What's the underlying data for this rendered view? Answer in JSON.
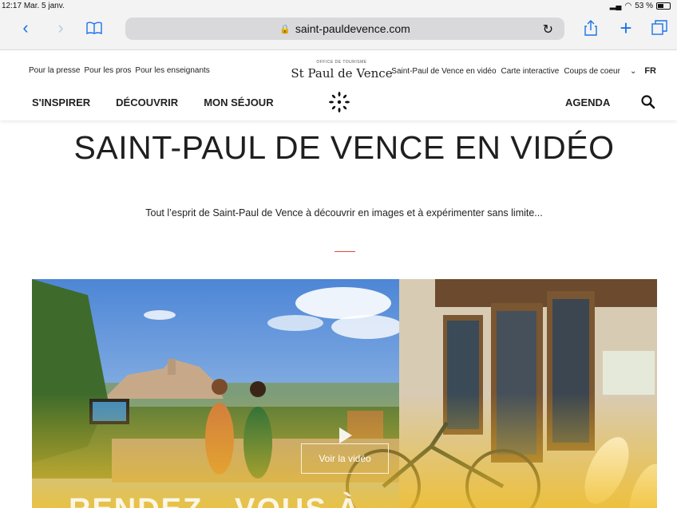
{
  "status_bar": {
    "time": "12:17",
    "date": "Mar. 5 janv.",
    "battery": "53 %",
    "battery_level": 0.53
  },
  "browser": {
    "url": "saint-pauldevence.com"
  },
  "colors": {
    "accent": "#1a73e8",
    "rule": "#d94a3b",
    "logo_sun": "#111111"
  },
  "header": {
    "top_links_left": [
      "Pour la presse",
      "Pour les pros",
      "Pour les enseignants"
    ],
    "top_links_right": [
      "Saint-Paul de Vence en vidéo",
      "Carte interactive",
      "Coups de coeur"
    ],
    "language": "FR",
    "logo_office": "OFFICE DE TOURISME",
    "logo_name": "St Paul de Vence",
    "main_nav": [
      "S'INSPIRER",
      "DÉCOUVRIR",
      "MON SÉJOUR"
    ],
    "agenda": "AGENDA"
  },
  "content": {
    "title": "SAINT-PAUL DE VENCE EN VIDÉO",
    "subtitle": "Tout l’esprit de Saint-Paul de Vence à découvrir en images et à expérimenter sans limite...",
    "video_button": "Voir la vidéo",
    "hero_heading": "RENDEZ - VOUS À"
  },
  "icons": [
    "back-icon",
    "forward-icon",
    "bookmarks-icon",
    "lock-icon",
    "reload-icon",
    "share-icon",
    "new-tab-icon",
    "tabs-icon",
    "chevron-down-icon",
    "search-icon",
    "play-icon"
  ]
}
